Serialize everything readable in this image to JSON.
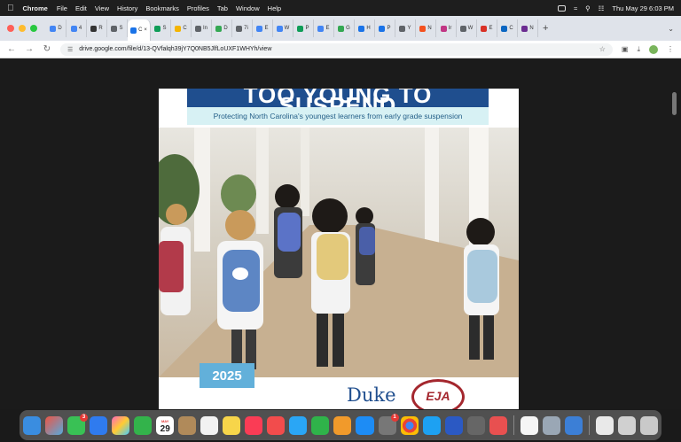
{
  "menubar": {
    "app": "Chrome",
    "items": [
      "File",
      "Edit",
      "View",
      "History",
      "Bookmarks",
      "Profiles",
      "Tab",
      "Window",
      "Help"
    ],
    "datetime": "Thu May 29  6:03 PM"
  },
  "tabs": [
    {
      "label": "D",
      "color": "#4285f4"
    },
    {
      "label": "4",
      "color": "#4285f4"
    },
    {
      "label": "R",
      "color": "#333333"
    },
    {
      "label": "S",
      "color": "#5f6368"
    },
    {
      "label": "C",
      "color": "#1a73e8",
      "active": true
    },
    {
      "label": "S",
      "color": "#0f9d58"
    },
    {
      "label": "C",
      "color": "#f4b400"
    },
    {
      "label": "In",
      "color": "#5f6368"
    },
    {
      "label": "D",
      "color": "#34a853"
    },
    {
      "label": "7i",
      "color": "#5f6368"
    },
    {
      "label": "E",
      "color": "#4285f4"
    },
    {
      "label": "W",
      "color": "#4285f4"
    },
    {
      "label": "P",
      "color": "#0f9d58"
    },
    {
      "label": "E",
      "color": "#4285f4"
    },
    {
      "label": "G",
      "color": "#34a853"
    },
    {
      "label": "H",
      "color": "#1a73e8"
    },
    {
      "label": "P",
      "color": "#1a73e8"
    },
    {
      "label": "Y",
      "color": "#5f6368"
    },
    {
      "label": "N",
      "color": "#f4511e"
    },
    {
      "label": "Ir",
      "color": "#c13584"
    },
    {
      "label": "W",
      "color": "#5f6368"
    },
    {
      "label": "E",
      "color": "#d93025"
    },
    {
      "label": "C",
      "color": "#0a66c2"
    },
    {
      "label": "N",
      "color": "#6b2c91"
    }
  ],
  "toolbar": {
    "url": "drive.google.com/file/d/13-QVfalqh39jY7Q0NB5JlfLoUXF1WHYh/view"
  },
  "document": {
    "title": "TOO YOUNG TO SUSPEND",
    "subtitle": "Protecting North Carolina's youngest learners from early grade suspension",
    "year": "2025",
    "logo_duke": "Duke",
    "logo_eja": "EJA"
  },
  "dock": {
    "messages_badge": "3",
    "calendar_month": "MAY",
    "calendar_day": "29",
    "chrome_badge": "1"
  }
}
